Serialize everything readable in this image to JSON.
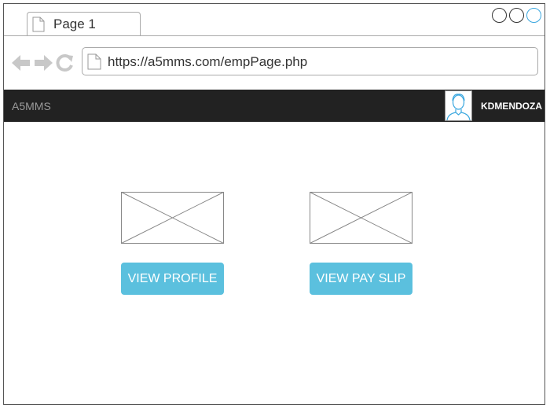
{
  "browser": {
    "tab_label": "Page 1",
    "url": "https://a5mms.com/empPage.php"
  },
  "appbar": {
    "brand": "A5MMS",
    "username": "KDMENDOZA"
  },
  "main": {
    "cards": [
      {
        "button_label": "VIEW PROFILE"
      },
      {
        "button_label": "VIEW PAY SLIP"
      }
    ]
  },
  "colors": {
    "navbar_bg": "#222222",
    "button_bg": "#5bc0de",
    "window_control_accent": "#3aa7df"
  }
}
